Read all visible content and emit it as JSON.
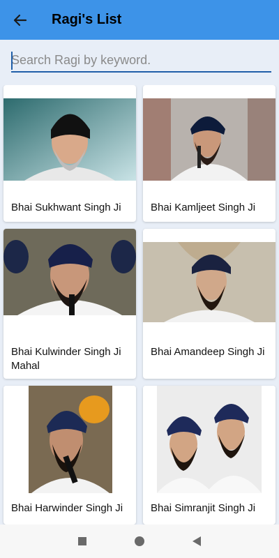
{
  "appbar": {
    "title": "Ragi's List",
    "back_icon": "arrow-back-icon",
    "color": "#3d93e8"
  },
  "search": {
    "placeholder": "Search Ragi by keyword.",
    "value": ""
  },
  "ragis": [
    {
      "name": "Bhai Sukhwant Singh Ji"
    },
    {
      "name": "Bhai Kamljeet Singh Ji"
    },
    {
      "name": "Bhai Kulwinder Singh Ji Mahal"
    },
    {
      "name": "Bhai Amandeep Singh Ji"
    },
    {
      "name": "Bhai Harwinder Singh Ji"
    },
    {
      "name": "Bhai Simranjit Singh Ji"
    }
  ],
  "navbar": {
    "recent_icon": "square-icon",
    "home_icon": "circle-icon",
    "back_icon": "triangle-back-icon"
  }
}
